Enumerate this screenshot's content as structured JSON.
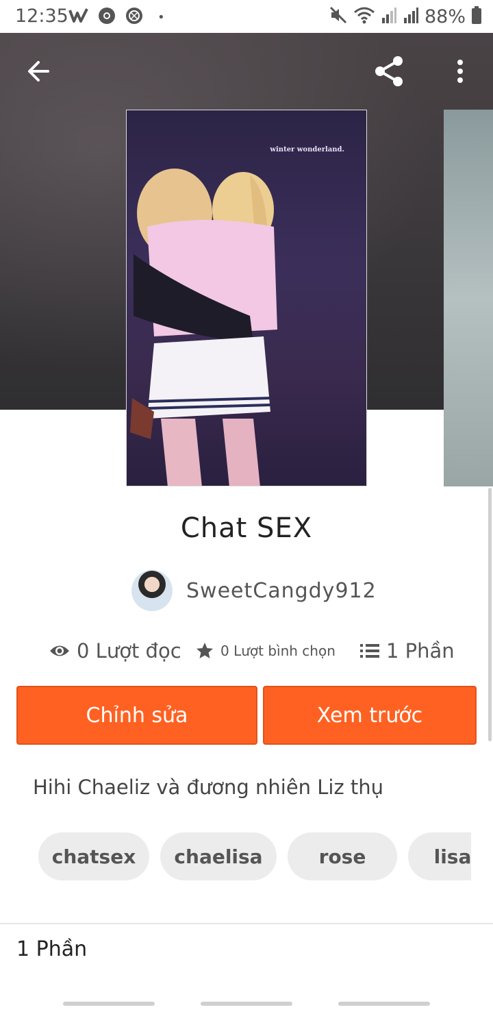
{
  "status_bar": {
    "time": "12:35",
    "battery": "88%"
  },
  "story": {
    "cover_caption": "winter wonderland.",
    "title": "Chat SEX",
    "author": "SweetCangdy912",
    "reads": "0 Lượt đọc",
    "votes": "0 Lượt bình chọn",
    "parts": "1 Phần",
    "description": "Hihi Chaeliz và đương nhiên Liz thụ",
    "tags": [
      "chatsex",
      "chaelisa",
      "rose",
      "lisa"
    ]
  },
  "actions": {
    "edit_label": "Chỉnh sửa",
    "preview_label": "Xem trước"
  },
  "parts_section": {
    "title": "1 Phần"
  },
  "colors": {
    "accent": "#ff6122",
    "tag_bg": "#ececec"
  },
  "icons": [
    "back-arrow-icon",
    "share-icon",
    "more-vert-icon",
    "eye-icon",
    "star-icon",
    "list-icon"
  ]
}
